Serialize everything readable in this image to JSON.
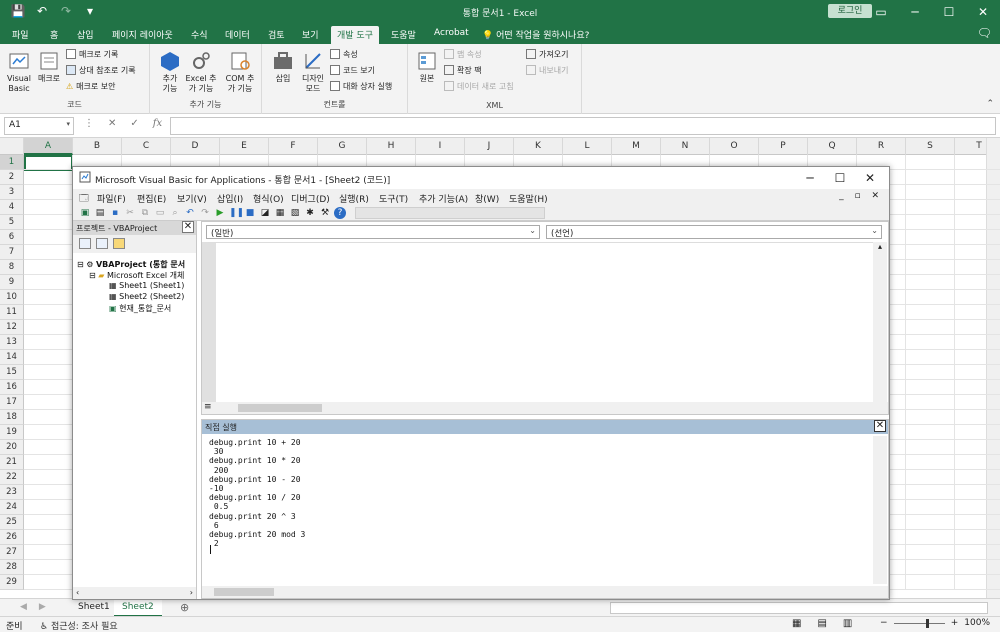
{
  "excel": {
    "title": "통합 문서1 - Excel",
    "login": "로그인",
    "qat": [
      "💾",
      "↶",
      "↷",
      "▾"
    ],
    "tabs": [
      "파일",
      "홈",
      "삽입",
      "페이지 레이아웃",
      "수식",
      "데이터",
      "검토",
      "보기",
      "개발 도구",
      "도움말",
      "Acrobat"
    ],
    "active_tab": "개발 도구",
    "tellme": "어떤 작업을 원하시나요?",
    "ribbon": {
      "code": {
        "label": "코드",
        "visual_basic": "Visual Basic",
        "macro": "매크로",
        "record_macro": "매크로 기록",
        "relative_ref": "상대 참조로 기록",
        "macro_security": "매크로 보안"
      },
      "addins": {
        "label": "추가 기능",
        "addins": "추가 기능",
        "excel_addins": "Excel 추가 기능",
        "com_addins": "COM 추가 기능"
      },
      "controls": {
        "label": "컨트롤",
        "insert": "삽입",
        "design_mode": "디자인 모드",
        "properties": "속성",
        "view_code": "코드 보기",
        "run_dialog": "대화 상자 실행"
      },
      "xml": {
        "label": "XML",
        "source": "원본",
        "map_properties": "맵 속성",
        "expansion_packs": "확장 팩",
        "refresh_data": "데이터 새로 고침",
        "import": "가져오기",
        "export": "내보내기"
      }
    },
    "namebox": "A1",
    "columns": [
      "A",
      "B",
      "C",
      "D",
      "E",
      "F",
      "G",
      "H",
      "I",
      "J",
      "K",
      "L",
      "M",
      "N",
      "O",
      "P",
      "Q",
      "R",
      "S",
      "T"
    ],
    "rows": [
      "1",
      "2",
      "3",
      "4",
      "5",
      "6",
      "7",
      "8",
      "9",
      "10",
      "11",
      "12",
      "13",
      "14",
      "15",
      "16",
      "17",
      "18",
      "19",
      "20",
      "21",
      "22",
      "23",
      "24",
      "25",
      "26",
      "27",
      "28",
      "29"
    ],
    "sheets": [
      "Sheet1",
      "Sheet2"
    ],
    "active_sheet": "Sheet2",
    "status": {
      "ready": "준비",
      "accessibility": "접근성: 조사 필요",
      "zoom": "100%"
    }
  },
  "vbe": {
    "title": "Microsoft Visual Basic for Applications - 통합 문서1 - [Sheet2 (코드)]",
    "menu": [
      "파일(F)",
      "편집(E)",
      "보기(V)",
      "삽입(I)",
      "형식(O)",
      "디버그(D)",
      "실행(R)",
      "도구(T)",
      "추가 기능(A)",
      "창(W)",
      "도움말(H)"
    ],
    "project_pane": {
      "title": "프로젝트 - VBAProject",
      "tree": [
        "VBAProject (통합 문서",
        "Microsoft Excel 개체",
        "Sheet1 (Sheet1)",
        "Sheet2 (Sheet2)",
        "현재_통합_문서"
      ]
    },
    "code_window": {
      "object_combo": "(일반)",
      "proc_combo": "(선언)"
    },
    "immediate": {
      "title": "직접 실행",
      "lines": [
        "debug.print 10 + 20",
        " 30",
        "debug.print 10 * 20",
        " 200",
        "debug.print 10 - 20",
        "-10",
        "debug.print 10 / 20",
        " 0.5",
        "debug.print 20 ^ 3",
        " 6",
        "debug.print 20 mod 3",
        " 2"
      ]
    }
  },
  "colors": {
    "excel_green": "#217346",
    "ribbon_bg": "#f3f3f3",
    "immediate_header": "#a7bfd6"
  }
}
